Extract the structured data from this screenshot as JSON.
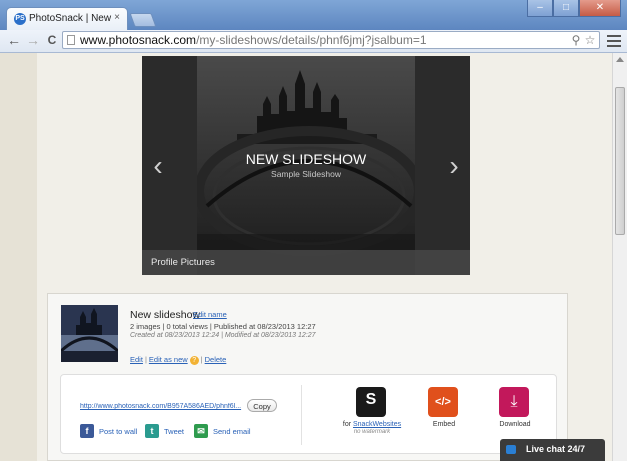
{
  "browser": {
    "tab_title": "PhotoSnack | New slidesho",
    "tab_close": "×",
    "favicon": "PS",
    "url_host": "www.photosnack.com",
    "url_path": "/my-slideshows/details/phnf6jmj?jsalbum=1",
    "win_min": "–",
    "win_max": "□",
    "win_close": "✕",
    "back": "←",
    "forward": "→",
    "reload": "C",
    "search": "⚲",
    "star": "☆"
  },
  "player": {
    "title": "NEW SLIDESHOW",
    "subtitle": "Sample Slideshow",
    "album": "Profile Pictures",
    "prev": "‹",
    "next": "›"
  },
  "details": {
    "title": "New slideshow",
    "edit_name": "Edit name",
    "stats": "2 images | 0 total views | Published at 08/23/2013 12:27",
    "dates": "Created at 08/23/2013 12:24 | Modified at 08/23/2013 12:27",
    "actions": {
      "edit": "Edit",
      "edit_as_new": "Edit as new",
      "help": "?",
      "delete": "Delete",
      "sep": "|"
    }
  },
  "share": {
    "link": "http://www.photosnack.com/B957A586AED/phnf6l...",
    "copy": "Copy",
    "post_to_wall": "Post to wall",
    "tweet": "Tweet",
    "send_email": "Send email",
    "fb_glyph": "f",
    "tw_glyph": "t",
    "mail_glyph": "✉"
  },
  "tools": {
    "snack_prefix": "for",
    "snack_link": "SnackWebsites",
    "snack_note": "no watermark",
    "snack_glyph": "S",
    "embed": "Embed",
    "embed_glyph": "</>",
    "download": "Download",
    "download_glyph": "⤓"
  },
  "livechat": {
    "label": "Live chat 24/7"
  },
  "colors": {
    "snack_tile": "#1a1a1a",
    "embed_tile": "#e0501c",
    "download_tile": "#c2185b",
    "facebook": "#3b5998",
    "twitter": "#2a9b8f",
    "email": "#2e9b4e"
  }
}
